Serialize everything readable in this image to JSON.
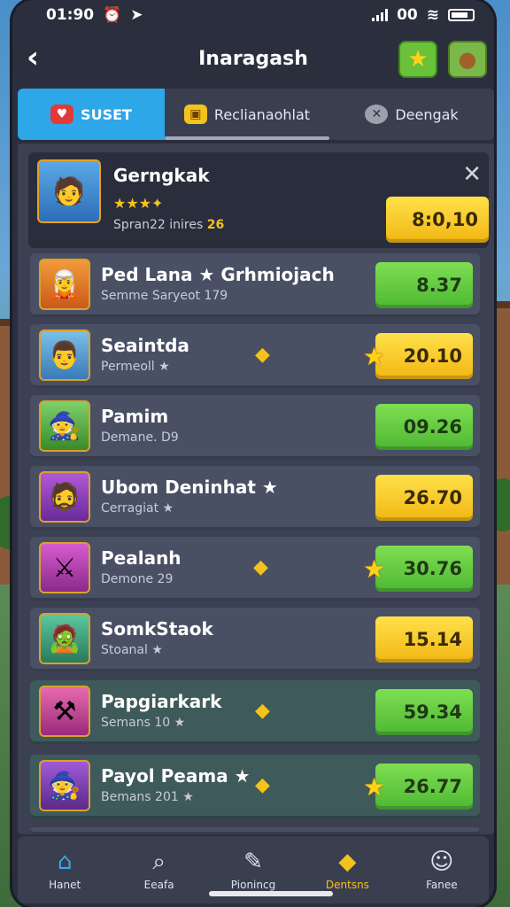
{
  "status_bar": {
    "time": "01:90",
    "right_text": "00"
  },
  "header": {
    "title": "Inaragash",
    "back_icon": "chevron-left-icon",
    "star_icon": "star-icon",
    "bag_icon": "bag-icon"
  },
  "tabs": [
    {
      "label": "SUSET",
      "icon": "heart-icon"
    },
    {
      "label": "Reclianaohlat",
      "icon": "chest-icon"
    },
    {
      "label": "Deengak",
      "icon": "compass-icon"
    }
  ],
  "featured": {
    "name": "Gerngkak",
    "sub": "Spran22 inires",
    "sub_value": "26",
    "score": "8:0,10"
  },
  "rows": [
    {
      "name": "Ped Lana ★ Grhmiojach",
      "sub": "Semme Saryeot 179",
      "score": "8.37",
      "color": "green"
    },
    {
      "name": "Seaintda",
      "sub": "Permeoll ★",
      "score": "20.10",
      "color": "yellow"
    },
    {
      "name": "Pamim",
      "sub": "Demane. D9",
      "score": "09.26",
      "color": "green"
    },
    {
      "name": "Ubom Deninhat ★",
      "sub": "Cerragiat ★",
      "score": "26.70",
      "color": "yellow"
    },
    {
      "name": "Pealanh",
      "sub": "Demone 29",
      "score": "30.76",
      "color": "green"
    },
    {
      "name": "SomkStaok",
      "sub": "Stoanal ★",
      "score": "15.14",
      "color": "yellow"
    },
    {
      "name": "Papgiarkark",
      "sub": "Semans 10 ★",
      "score": "59.34",
      "color": "green"
    },
    {
      "name": "Payol Peama ★",
      "sub": "Bemans 201 ★",
      "score": "26.77",
      "color": "green"
    }
  ],
  "nav": [
    {
      "label": "Hanet",
      "icon": "home-icon"
    },
    {
      "label": "Eeafa",
      "icon": "search-icon"
    },
    {
      "label": "Pionincg",
      "icon": "pencil-icon"
    },
    {
      "label": "Dentsns",
      "icon": "bookmark-icon"
    },
    {
      "label": "Fanee",
      "icon": "user-icon"
    }
  ],
  "colors": {
    "accent_blue": "#2ea7e8",
    "score_green": "#4db833",
    "score_yellow": "#f1b613"
  }
}
